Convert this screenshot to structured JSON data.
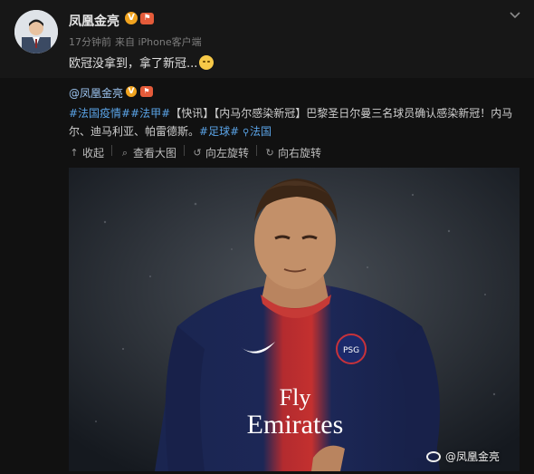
{
  "post": {
    "author": "凤凰金亮",
    "badge_verified": "V",
    "badge_level": "⚑",
    "time": "17分钟前",
    "source": "来自 iPhone客户端",
    "text": "欧冠没拿到，拿了新冠..."
  },
  "repost": {
    "author": "@凤凰金亮",
    "badge_verified": "V",
    "badge_level": "⚑",
    "tag1": "#法国疫情#",
    "tag2": "#法甲#",
    "body": "【快讯】【内马尔感染新冠】巴黎圣日尔曼三名球员确认感染新冠！内马尔、迪马利亚、帕雷德斯。",
    "tag3": "#足球#",
    "location": "法国"
  },
  "actions": {
    "collapse": "收起",
    "view_large": "查看大图",
    "rotate_left": "向左旋转",
    "rotate_right": "向右旋转"
  },
  "photo": {
    "watermark": "@凤凰金亮",
    "shirt_sponsor_1": "Fly",
    "shirt_sponsor_2": "Emirates",
    "shirt_badge": "PSG"
  },
  "colors": {
    "link": "#5aa3e6",
    "background": "#171717"
  }
}
